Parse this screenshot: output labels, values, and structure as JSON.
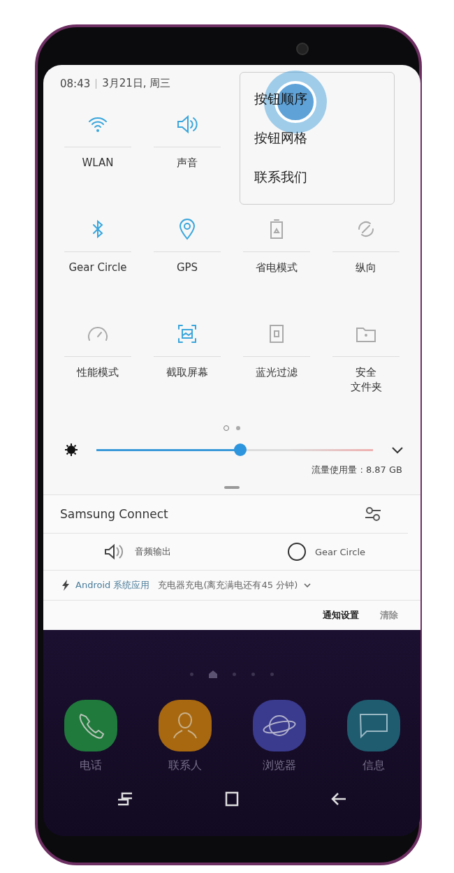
{
  "status": {
    "time": "08:43",
    "date": "3月21日, 周三"
  },
  "tile_rows": [
    [
      {
        "lines": [
          "WLAN"
        ],
        "on": true
      },
      {
        "lines": [
          "声音"
        ],
        "on": true
      }
    ],
    [
      {
        "lines": [
          "Gear Circle"
        ],
        "on": true
      },
      {
        "lines": [
          "GPS"
        ],
        "on": true
      },
      {
        "lines": [
          "省电模式"
        ],
        "on": false
      },
      {
        "lines": [
          "纵向"
        ],
        "on": false
      }
    ],
    [
      {
        "lines": [
          "性能模式"
        ],
        "on": false
      },
      {
        "lines": [
          "截取屏幕"
        ],
        "on": true
      },
      {
        "lines": [
          "蓝光过滤"
        ],
        "on": false
      },
      {
        "lines": [
          "安全",
          "文件夹"
        ],
        "on": false
      }
    ]
  ],
  "menu": {
    "items": [
      {
        "label": "按钮顺序",
        "selected": true
      },
      {
        "label": "按钮网格",
        "selected": false
      },
      {
        "label": "联系我们",
        "selected": false
      }
    ]
  },
  "panel_pages": [
    {
      "selected": true
    },
    {
      "selected": false
    }
  ],
  "brightness": {
    "level": 0.52
  },
  "data_usage": "流量使用量 : 8.87 GB",
  "connect": {
    "title": "Samsung Connect",
    "devices": [
      {
        "label": "音频输出"
      },
      {
        "label": "Gear Circle"
      }
    ]
  },
  "notification": {
    "app": "Android 系统应用",
    "text": "充电器充电(离充满电还有45 分钟)"
  },
  "footer": [
    {
      "label": "通知设置",
      "disabled": false
    },
    {
      "label": "清除",
      "disabled": true
    }
  ],
  "home_pages": [
    {
      "selected": false
    },
    {
      "selected": true
    },
    {
      "selected": false
    },
    {
      "selected": false
    },
    {
      "selected": false
    }
  ],
  "dock": [
    {
      "label": "电话",
      "color": "#1f7a3c"
    },
    {
      "label": "联系人",
      "color": "#a8680f"
    },
    {
      "label": "浏览器",
      "color": "#3a3a8e"
    },
    {
      "label": "信息",
      "color": "#1f5c70"
    }
  ]
}
